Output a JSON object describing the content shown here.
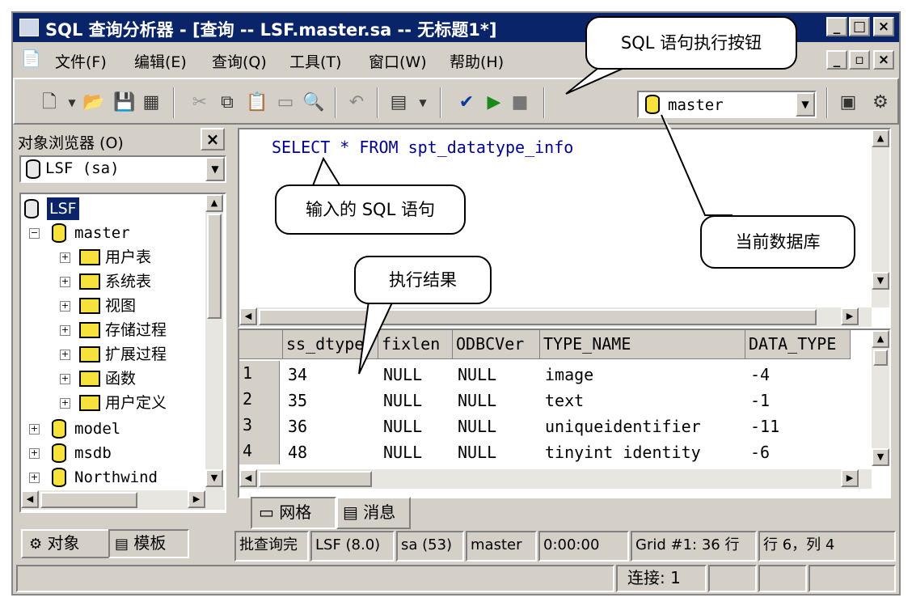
{
  "window": {
    "title": "SQL 查询分析器 - [查询 -- LSF.master.sa -- 无标题1*]"
  },
  "menu": [
    "文件(F)",
    "编辑(E)",
    "查询(Q)",
    "工具(T)",
    "窗口(W)",
    "帮助(H)"
  ],
  "toolbar": {
    "database": "master"
  },
  "object_browser": {
    "title": "对象浏览器 (O)",
    "server_combo": "LSF (sa)",
    "tree": {
      "root": "LSF",
      "master": "master",
      "master_children": [
        "用户表",
        "系统表",
        "视图",
        "存储过程",
        "扩展过程",
        "函数",
        "用户定义"
      ],
      "other_dbs": [
        "model",
        "msdb",
        "Northwind"
      ]
    },
    "tabs": [
      "对象",
      "模板"
    ]
  },
  "editor": {
    "sql": "SELECT * FROM spt_datatype_info"
  },
  "results": {
    "columns": [
      "ss_dtype",
      "fixlen",
      "ODBCVer",
      "TYPE_NAME",
      "DATA_TYPE"
    ],
    "rows": [
      {
        "n": "1",
        "cells": [
          "34",
          "NULL",
          "NULL",
          "image",
          "-4"
        ]
      },
      {
        "n": "2",
        "cells": [
          "35",
          "NULL",
          "NULL",
          "text",
          "-1"
        ]
      },
      {
        "n": "3",
        "cells": [
          "36",
          "NULL",
          "NULL",
          "uniqueidentifier",
          "-11"
        ]
      },
      {
        "n": "4",
        "cells": [
          "48",
          "NULL",
          "NULL",
          "tinyint identity",
          "-6"
        ]
      }
    ],
    "tabs": [
      "网格",
      "消息"
    ]
  },
  "status": {
    "batch": "批查询完",
    "server": "LSF (8.0)",
    "user": "sa (53)",
    "db": "master",
    "time": "0:00:00",
    "grid": "Grid #1: 36 行",
    "position": "行 6，列 4",
    "connections": "连接: 1"
  },
  "callouts": {
    "exec_button": "SQL 语句执行按钮",
    "sql_input": "输入的 SQL 语句",
    "current_db": "当前数据库",
    "results": "执行结果"
  }
}
